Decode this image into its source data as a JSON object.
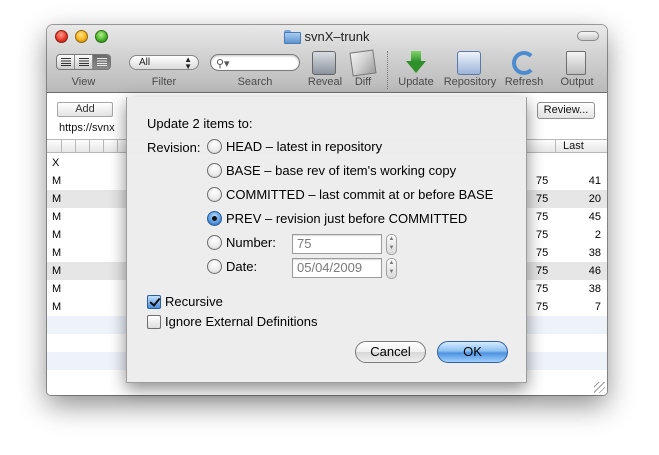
{
  "window": {
    "title": "svnX–trunk"
  },
  "toolbar": {
    "view_label": "View",
    "filter_label": "Filter",
    "filter_value": "All",
    "search_label": "Search",
    "reveal_label": "Reveal",
    "diff_label": "Diff",
    "update_label": "Update",
    "repository_label": "Repository",
    "refresh_label": "Refresh",
    "output_label": "Output"
  },
  "actions": {
    "add_label": "Add",
    "review_label": "Review..."
  },
  "url": "https://svnx",
  "table": {
    "last_header": "Last",
    "rows": [
      {
        "status": "X",
        "rev": "",
        "last": ""
      },
      {
        "status": "M",
        "rev": "75",
        "last": "41"
      },
      {
        "status": "M",
        "rev": "75",
        "last": "20"
      },
      {
        "status": "M",
        "rev": "75",
        "last": "45"
      },
      {
        "status": "M",
        "rev": "75",
        "last": "2"
      },
      {
        "status": "M",
        "rev": "75",
        "last": "38"
      },
      {
        "status": "M",
        "rev": "75",
        "last": "46"
      },
      {
        "status": "M",
        "rev": "75",
        "last": "38"
      },
      {
        "status": "M",
        "rev": "75",
        "last": "7"
      }
    ]
  },
  "dialog": {
    "title": "Update 2 items to:",
    "revision_label": "Revision:",
    "options": {
      "head": "HEAD – latest in repository",
      "base": "BASE – base rev of item's working copy",
      "committed": "COMMITTED – last commit at or before BASE",
      "prev": "PREV – revision just before COMMITTED",
      "number": "Number:",
      "date": "Date:"
    },
    "selected_option": "prev",
    "number_value": "75",
    "date_value": "05/04/2009",
    "recursive_label": "Recursive",
    "recursive_checked": true,
    "ignore_external_label": "Ignore External Definitions",
    "ignore_external_checked": false,
    "cancel_label": "Cancel",
    "ok_label": "OK"
  }
}
